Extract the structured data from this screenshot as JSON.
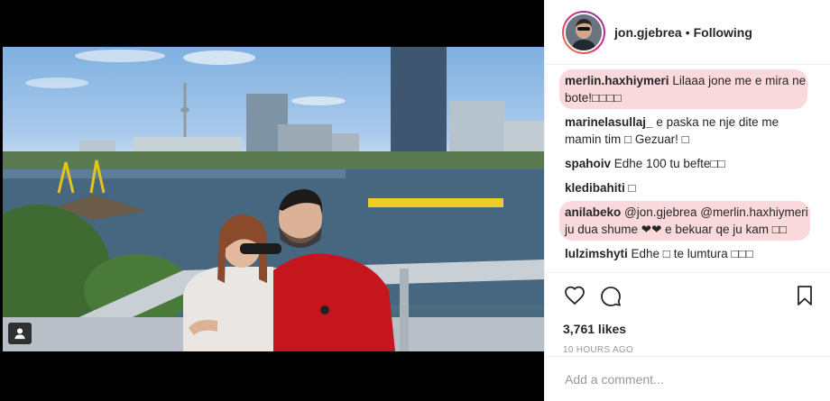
{
  "post": {
    "username": "jon.gjebrea",
    "separator": "•",
    "follow_status": "Following",
    "likes": "3,761 likes",
    "timestamp": "10 HOURS AGO",
    "add_comment_placeholder": "Add a comment..."
  },
  "comments": [
    {
      "user": "merlin.haxhiymeri",
      "text": "Lilaaa jone me e mira ne bote!□□□□",
      "highlighted": true
    },
    {
      "user": "marinelasullaj_",
      "text": "e paska ne nje dite me mamin tim □ Gezuar! □",
      "highlighted": false
    },
    {
      "user": "spahoiv",
      "text": "Edhe 100 tu befte□□",
      "highlighted": false
    },
    {
      "user": "kledibahiti",
      "text": "□",
      "highlighted": false
    },
    {
      "user": "anilabeko",
      "text": "@jon.gjebrea @merlin.haxhiymeri ju dua shume ❤❤ e bekuar qe ju kam □□",
      "highlighted": true
    },
    {
      "user": "lulzimshyti",
      "text": "Edhe □ te lumtura □□□",
      "highlighted": false
    }
  ],
  "icons": {
    "like": "heart-icon",
    "comment": "comment-icon",
    "save": "bookmark-icon",
    "user_tag": "person-icon"
  },
  "colors": {
    "highlight": "#f4aab4",
    "avatar_ring_start": "#f58529",
    "avatar_ring_end": "#8134af",
    "muted": "#999999"
  }
}
